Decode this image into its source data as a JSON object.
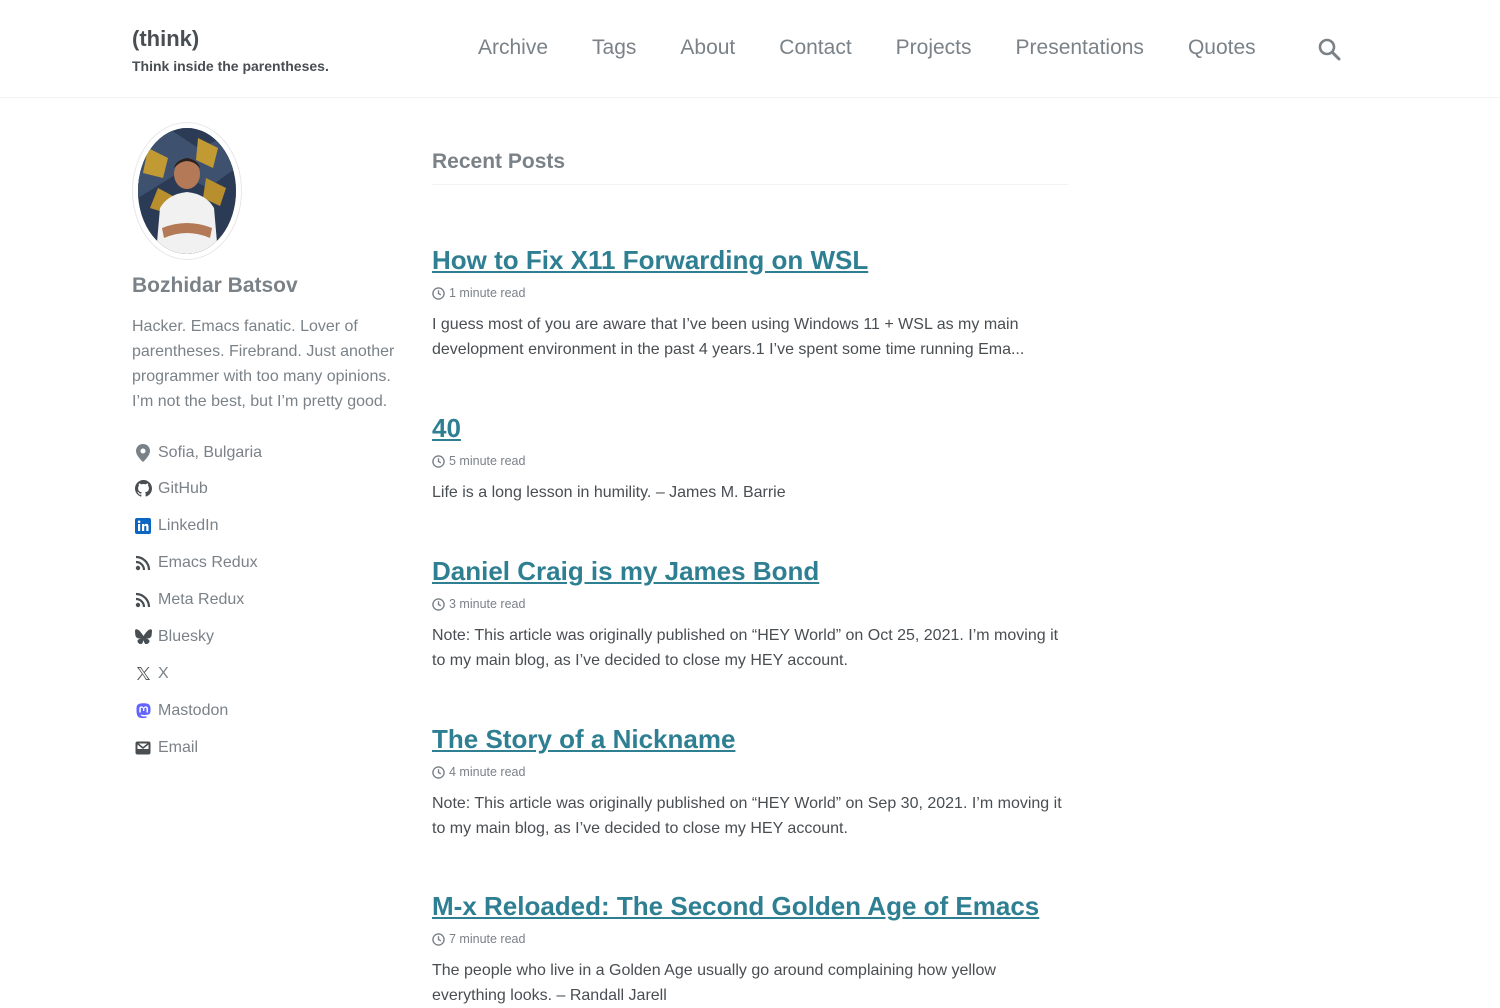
{
  "site": {
    "title": "(think)",
    "subtitle": "Think inside the parentheses."
  },
  "nav": [
    {
      "label": "Archive"
    },
    {
      "label": "Tags"
    },
    {
      "label": "About"
    },
    {
      "label": "Contact"
    },
    {
      "label": "Projects"
    },
    {
      "label": "Presentations"
    },
    {
      "label": "Quotes"
    }
  ],
  "author": {
    "name": "Bozhidar Batsov",
    "bio": "Hacker. Emacs fanatic. Lover of parentheses. Firebrand. Just another programmer with too many opinions. I’m not the best, but I’m pretty good.",
    "links": [
      {
        "label": "Sofia, Bulgaria",
        "icon": "location-pin-icon"
      },
      {
        "label": "GitHub",
        "icon": "github-icon"
      },
      {
        "label": "LinkedIn",
        "icon": "linkedin-icon"
      },
      {
        "label": "Emacs Redux",
        "icon": "rss-icon"
      },
      {
        "label": "Meta Redux",
        "icon": "rss-icon"
      },
      {
        "label": "Bluesky",
        "icon": "bluesky-icon"
      },
      {
        "label": "X",
        "icon": "x-icon"
      },
      {
        "label": "Mastodon",
        "icon": "mastodon-icon"
      },
      {
        "label": "Email",
        "icon": "email-icon"
      }
    ]
  },
  "main": {
    "section_title": "Recent Posts",
    "posts": [
      {
        "title": "How to Fix X11 Forwarding on WSL",
        "read_time": "1 minute read",
        "excerpt": "I guess most of you are aware that I’ve been using Windows 11 + WSL as my main development environment in the past 4 years.1 I’ve spent some time running Ema..."
      },
      {
        "title": "40",
        "read_time": "5 minute read",
        "excerpt": "Life is a long lesson in humility. – James M. Barrie"
      },
      {
        "title": "Daniel Craig is my James Bond",
        "read_time": "3 minute read",
        "excerpt": "Note: This article was originally published on “HEY World” on Oct 25, 2021. I’m moving it to my main blog, as I’ve decided to close my HEY account."
      },
      {
        "title": "The Story of a Nickname",
        "read_time": "4 minute read",
        "excerpt": "Note: This article was originally published on “HEY World” on Sep 30, 2021. I’m moving it to my main blog, as I’ve decided to close my HEY account."
      },
      {
        "title": "M-x Reloaded: The Second Golden Age of Emacs",
        "read_time": "7 minute read",
        "excerpt": "The people who live in a Golden Age usually go around complaining how yellow everything looks. – Randall Jarell"
      }
    ]
  },
  "colors": {
    "link": "#2f7f93",
    "muted": "#7a8288",
    "text": "#494e52",
    "linkedin": "#0a66c2",
    "mastodon": "#6364ff"
  }
}
